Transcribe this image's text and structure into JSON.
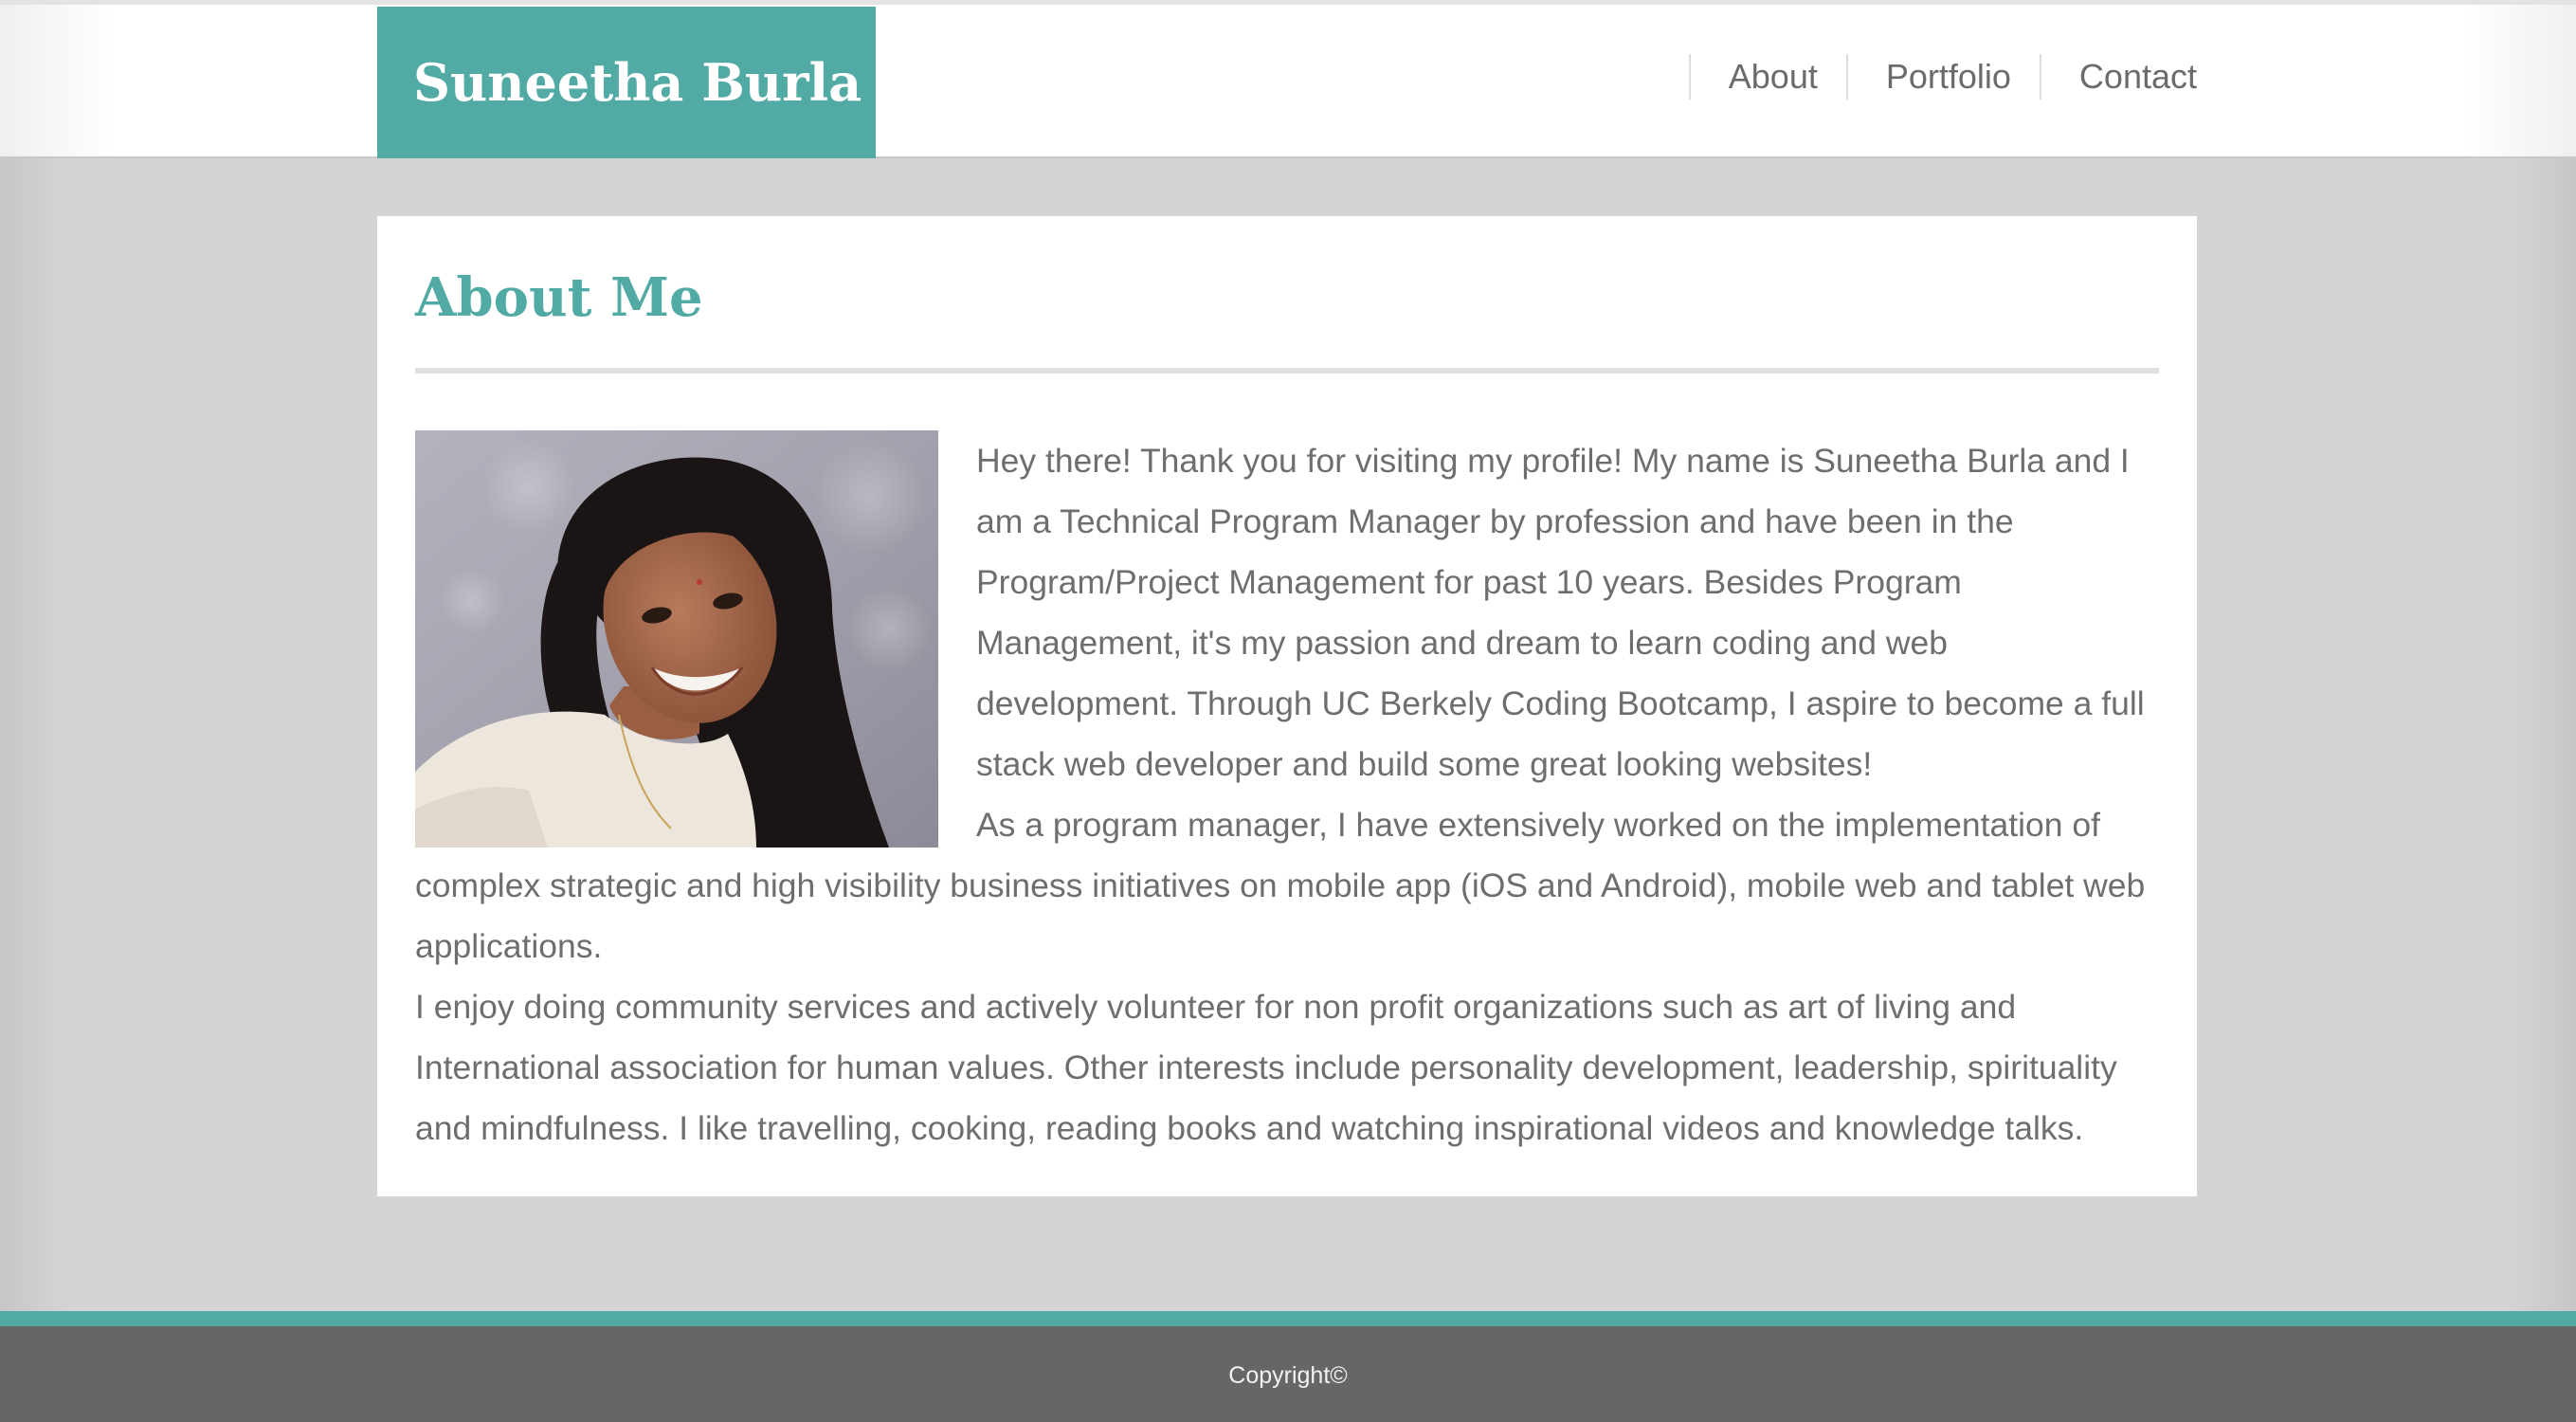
{
  "header": {
    "brand": "Suneetha Burla",
    "nav": [
      {
        "label": "About"
      },
      {
        "label": "Portfolio"
      },
      {
        "label": "Contact"
      }
    ]
  },
  "about": {
    "title": "About Me",
    "photo_alt": "Portrait of Suneetha Burla",
    "paragraphs": [
      "Hey there! Thank you for visiting my profile! My name is Suneetha Burla and I am a Technical Program Manager by profession and have been in the Program/Project Management for past 10 years. Besides Program Management, it's my passion and dream to learn coding and web development. Through UC Berkely Coding Bootcamp, I aspire to become a full stack web developer and build some great looking websites!",
      "As a program manager, I have extensively worked on the implementation of complex strategic and high visibility business initiatives on mobile app (iOS and Android), mobile web and tablet web applications.",
      "I enjoy doing community services and actively volunteer for non profit organizations such as art of living and International association for human values. Other interests include personality development, leadership, spirituality and mindfulness. I like travelling, cooking, reading books and watching inspirational videos and knowledge talks."
    ]
  },
  "footer": {
    "copyright": "Copyright©"
  },
  "colors": {
    "accent": "#52aaa4",
    "page_bg": "#d4d4d4",
    "footer_bg": "#666666",
    "text": "#6e6e6e"
  }
}
